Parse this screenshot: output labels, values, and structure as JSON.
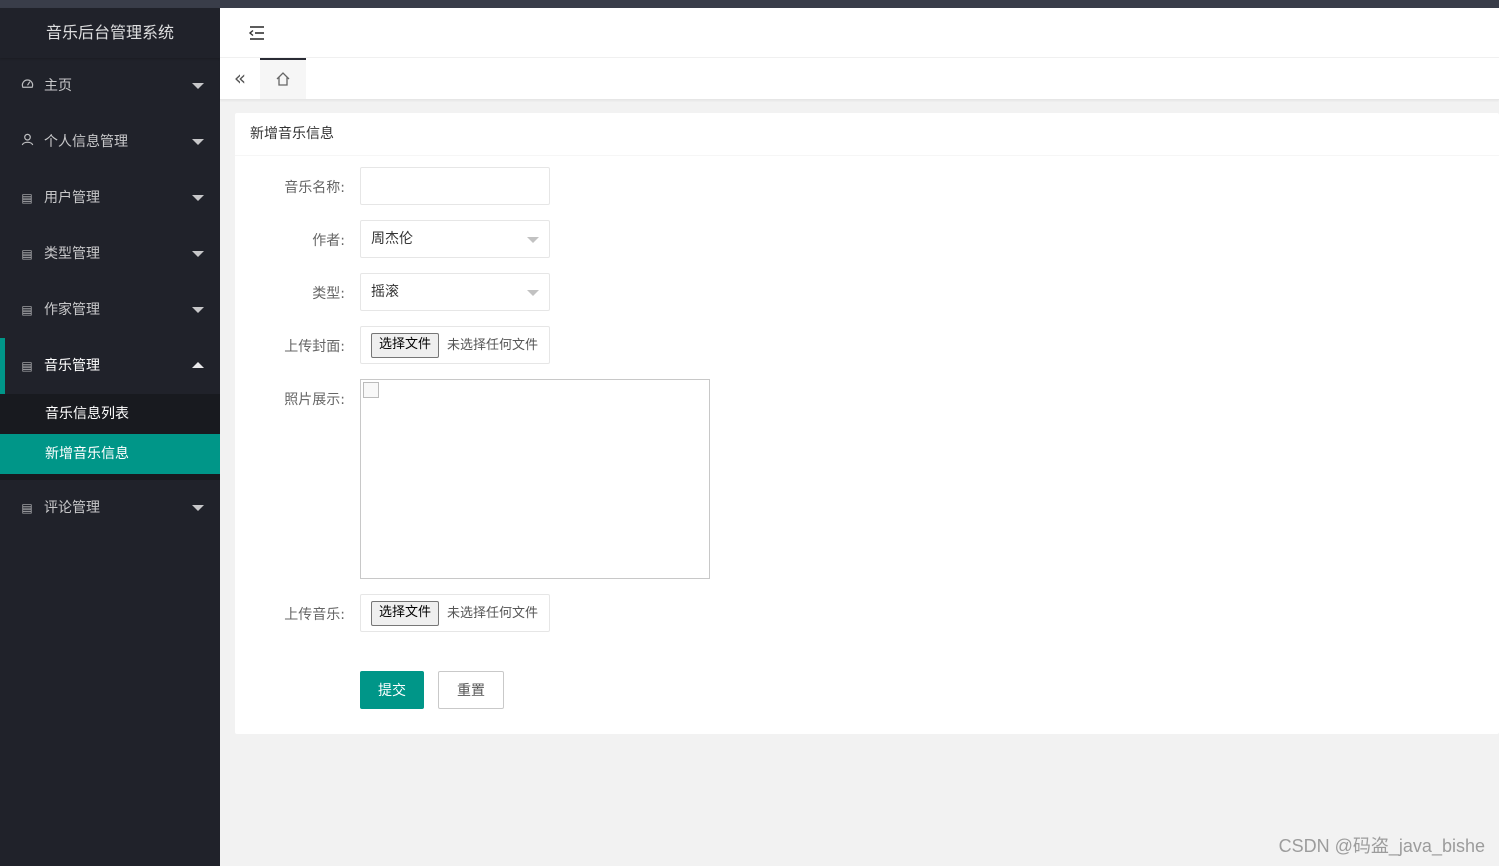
{
  "sidebar": {
    "logo": "音乐后台管理系统",
    "items": [
      {
        "label": "主页",
        "icon": "dashboard-icon"
      },
      {
        "label": "个人信息管理",
        "icon": "user-icon"
      },
      {
        "label": "用户管理",
        "icon": "file-icon"
      },
      {
        "label": "类型管理",
        "icon": "file-icon"
      },
      {
        "label": "作家管理",
        "icon": "file-icon"
      },
      {
        "label": "音乐管理",
        "icon": "file-icon"
      },
      {
        "label": "评论管理",
        "icon": "file-icon"
      }
    ],
    "subitems": [
      {
        "label": "音乐信息列表"
      },
      {
        "label": "新增音乐信息"
      }
    ]
  },
  "form": {
    "title": "新增音乐信息",
    "name_label": "音乐名称:",
    "name_value": "",
    "author_label": "作者:",
    "author_value": "周杰伦",
    "type_label": "类型:",
    "type_value": "摇滚",
    "cover_label": "上传封面:",
    "photo_label": "照片展示:",
    "music_label": "上传音乐:",
    "file_button": "选择文件",
    "file_none": "未选择任何文件",
    "submit": "提交",
    "reset": "重置"
  },
  "watermark": "CSDN @码盗_java_bishe",
  "colors": {
    "accent": "#009688",
    "sidebar_bg": "#20222a"
  }
}
